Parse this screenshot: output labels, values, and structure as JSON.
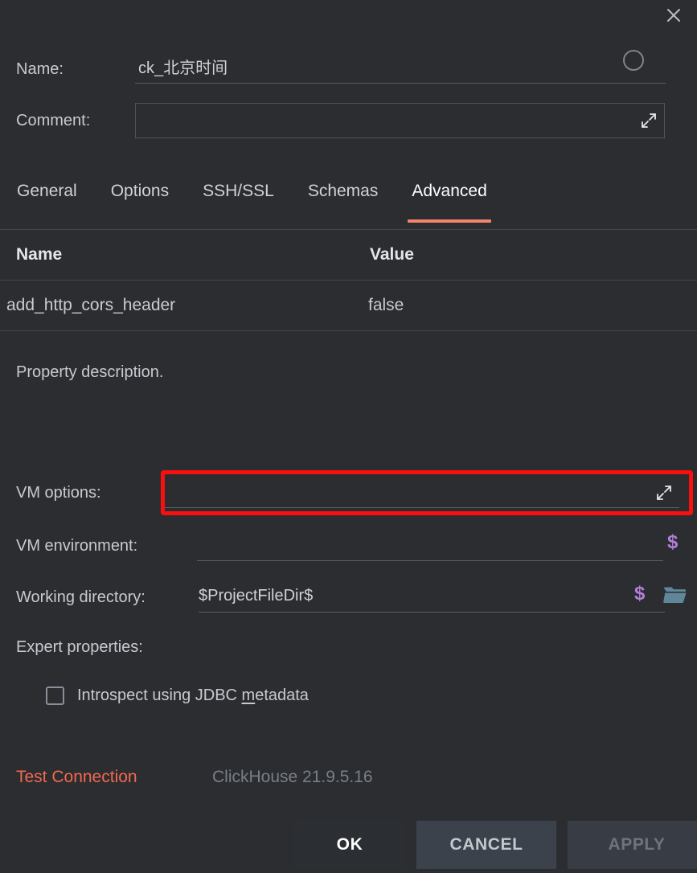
{
  "dialog": {
    "close_label": "×",
    "name_label": "Name:",
    "name_value": "ck_北京时间",
    "comment_label": "Comment:",
    "comment_value": "",
    "comment_placeholder": ""
  },
  "tabs": [
    {
      "label": "General",
      "active": false
    },
    {
      "label": "Options",
      "active": false
    },
    {
      "label": "SSH/SSL",
      "active": false
    },
    {
      "label": "Schemas",
      "active": false
    },
    {
      "label": "Advanced",
      "active": true
    }
  ],
  "property_table": {
    "columns": [
      "Name",
      "Value"
    ],
    "rows": [
      {
        "name": "add_http_cors_header",
        "value": "false"
      }
    ]
  },
  "description": "Property description.",
  "advanced_form": {
    "vm_options_label": "VM options:",
    "vm_options_value": "",
    "vm_environment_label": "VM environment:",
    "vm_environment_value": "",
    "working_directory_label": "Working directory:",
    "working_directory_value": "$ProjectFileDir$",
    "expert_properties_label": "Expert properties:",
    "introspect_checkbox_label_before": "Introspect using JDBC ",
    "introspect_checkbox_mnemonic": "m",
    "introspect_checkbox_label_after": "etadata",
    "introspect_checked": false,
    "macro_icon_glyph": "$"
  },
  "status": {
    "test_connection_label": "Test Connection",
    "db_version": "ClickHouse 21.9.5.16"
  },
  "buttons": {
    "ok": "OK",
    "cancel": "CANCEL",
    "apply": "APPLY"
  },
  "colors": {
    "background": "#2b2d30",
    "accent_underline": "#f2846b",
    "test_connection": "#f2684f",
    "macro_purple": "#b07fd8",
    "folder_icon": "#5f8799",
    "annotation_red": "#fa0f0f",
    "text_primary": "#c9ccd1",
    "text_muted": "#787f89"
  },
  "annotation": {
    "shape": "rectangle",
    "target": "vm-options-field",
    "color": "#fa0f0f"
  }
}
